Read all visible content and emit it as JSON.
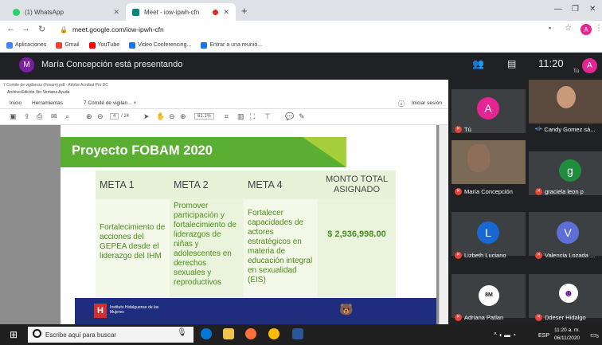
{
  "browser": {
    "tabs": [
      {
        "label": "(1) WhatsApp",
        "color": "#25d366"
      },
      {
        "label": "Meet - iow-ipwh-cfn",
        "color": "#00897b"
      }
    ],
    "new_tab": "+",
    "url": "meet.google.com/iow-ipwh-cfn",
    "bookmarks": [
      "Aplicaciones",
      "Gmail",
      "YouTube",
      "Video Conferencing...",
      "Entrar a una reunió..."
    ],
    "profile_initial": "A"
  },
  "meet": {
    "presenter_initial": "M",
    "presenting_text": "María Concepción está presentando",
    "time": "11:20",
    "me_label": "Tú",
    "me_initial": "A",
    "participants": [
      {
        "name": "Tú",
        "initial": "A",
        "color": "#e52592"
      },
      {
        "name": "Candy Gomez sá...",
        "initial": "",
        "color": "#3c4043"
      },
      {
        "name": "María Concepción",
        "initial": "",
        "color": "#3c4043"
      },
      {
        "name": "graciela leon p",
        "initial": "g",
        "color": "#1e8e3e"
      },
      {
        "name": "Lizbeth Luciano",
        "initial": "L",
        "color": "#1967d2"
      },
      {
        "name": "Valencia Lozada ...",
        "initial": "V",
        "color": "#5e6fd8"
      },
      {
        "name": "Adriana Patlan",
        "initial": "",
        "color": "#3c4043"
      },
      {
        "name": "Ddeser Hidalgo",
        "initial": "",
        "color": "#3c4043"
      }
    ]
  },
  "acrobat": {
    "title": "7 Comite de vigilancia (Fovam).pdf - Adobe Acrobat Pro DC",
    "menu": "Archivo  Edición  Ver  Ventana  Ayuda",
    "tabs": [
      "Inicio",
      "Herramientas",
      "7 Comité de vigilan... ×"
    ],
    "signin": "Iniciar sesión",
    "page": "4",
    "pages": "/ 24",
    "zoom": "61.1%"
  },
  "slide": {
    "title": "Proyecto FOBAM 2020",
    "headers": [
      "META 1",
      "META 2",
      "META 4",
      "MONTO TOTAL ASIGNADO"
    ],
    "cells": [
      "Fortalecimiento de acciones del GEPEA desde el liderazgo del IHM",
      "Promover participación y fortalecimiento de liderazgos de niñas y adolescentes en derechos sexuales y reproductivos",
      "Fortalecer capacidades de actores estratégicos en materia de educación integral en sexualidad (EIS)",
      "$ 2,936,998.00"
    ],
    "footer": "Instituto Hidalguense de las Mujeres"
  },
  "taskbar": {
    "search_placeholder": "Escribe aquí para buscar",
    "lang": "ESP",
    "time": "11:20 a. m.",
    "date": "06/11/2020",
    "notif": "3"
  }
}
